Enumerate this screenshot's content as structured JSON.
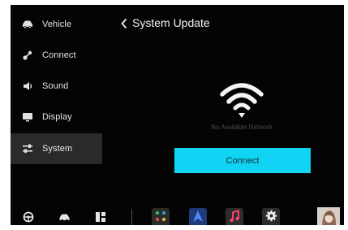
{
  "header": {
    "title": "System Update"
  },
  "sidebar": {
    "items": [
      {
        "label": "Vehicle",
        "icon": "car-icon",
        "active": false
      },
      {
        "label": "Connect",
        "icon": "bluetooth-connect-icon",
        "active": false
      },
      {
        "label": "Sound",
        "icon": "speaker-icon",
        "active": false
      },
      {
        "label": "Display",
        "icon": "display-icon",
        "active": false
      },
      {
        "label": "System",
        "icon": "sliders-icon",
        "active": true
      }
    ]
  },
  "main": {
    "status_text": "No Available Network",
    "connect_label": "Connect",
    "wifi_icon": "wifi-icon"
  },
  "dock": {
    "quick_buttons": [
      "steering-wheel-icon",
      "car-icon",
      "grid-icon"
    ],
    "apps": [
      {
        "icon": "phone-app-icon",
        "color": "#2b2b2b"
      },
      {
        "icon": "navigation-app-icon",
        "color": "#1f3a78"
      },
      {
        "icon": "music-app-icon",
        "color": "#2d2d2d"
      },
      {
        "icon": "settings-app-icon",
        "color": "#2b2b2b"
      }
    ],
    "avatar": "user-avatar"
  },
  "colors": {
    "accent": "#11d3f3",
    "background": "#040404",
    "active_item": "#2a2a2a"
  }
}
